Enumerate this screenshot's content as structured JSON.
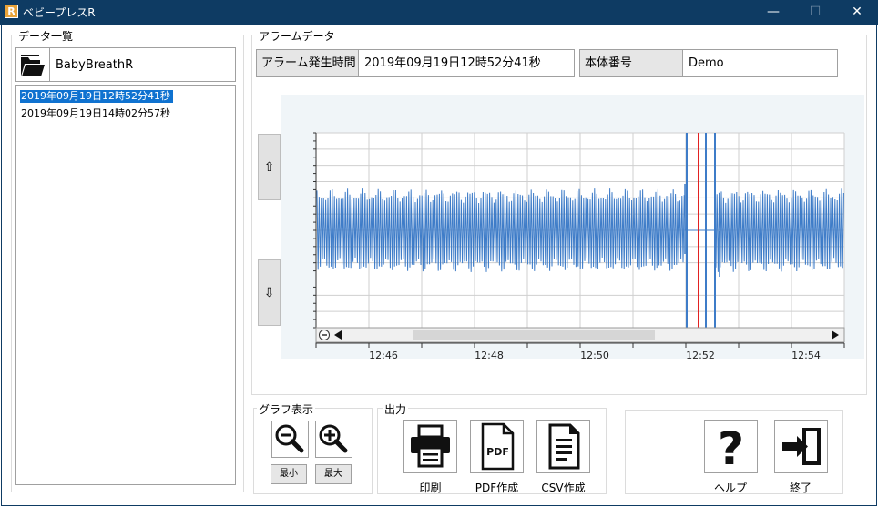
{
  "window": {
    "title": "ベビープレスR",
    "app_icon_letter": "R",
    "minimize_glyph": "—",
    "maximize_glyph": "☐",
    "close_glyph": "✕"
  },
  "data_list": {
    "label": "データ一覧",
    "device_name": "BabyBreathR",
    "items": [
      "2019年09月19日12時52分41秒",
      "2019年09月19日14時02分57秒"
    ],
    "selected_index": 0
  },
  "alarm": {
    "label": "アラームデータ",
    "time_label": "アラーム発生時間",
    "time_value": "2019年09月19日12時52分41秒",
    "serial_label": "本体番号",
    "serial_value": "Demo",
    "up_glyph": "⇧",
    "down_glyph": "⇩"
  },
  "chart_data": {
    "type": "line",
    "x_ticks": [
      "12:46",
      "12:48",
      "12:50",
      "12:52",
      "12:54"
    ],
    "series_color": "#3e7cc8",
    "marker_color": "#e22222",
    "grid": true
  },
  "graph_display": {
    "label": "グラフ表示",
    "zoom_out_icon": "zoom-out-icon",
    "zoom_in_icon": "zoom-in-icon",
    "min_label": "最小",
    "max_label": "最大"
  },
  "output": {
    "label": "出力",
    "print_label": "印刷",
    "pdf_label": "PDF作成",
    "pdf_icon_text": "PDF",
    "csv_label": "CSV作成"
  },
  "misc": {
    "help_label": "ヘルプ",
    "exit_label": "終了",
    "help_glyph": "?"
  },
  "colors": {
    "titlebar": "#0e3b63",
    "selection": "#0f72d0"
  }
}
